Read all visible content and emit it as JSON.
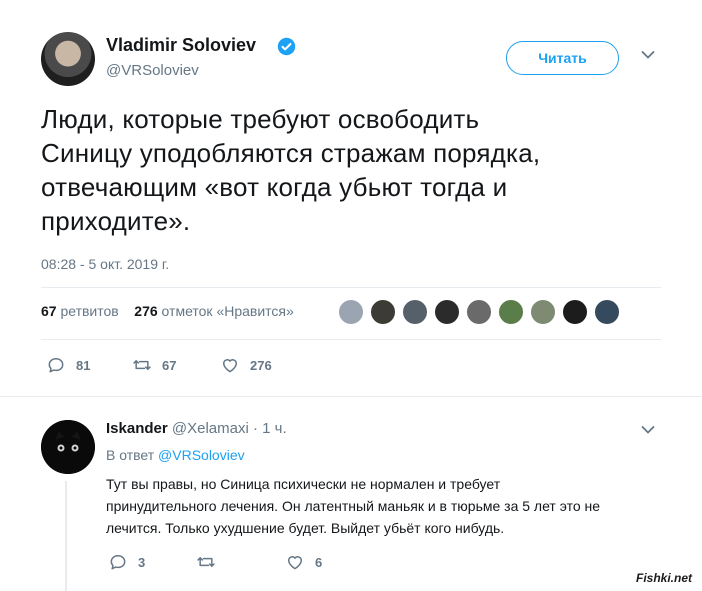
{
  "author": {
    "name": "Vladimir Soloviev",
    "handle": "@VRSoloviev",
    "verified": true
  },
  "follow_button": {
    "label": "Читать"
  },
  "tweet": {
    "text_lines": [
      "Люди, которые требуют освободить",
      "Синицу уподобляются стражам порядка,",
      "отвечающим «вот когда убьют тогда и",
      "приходите»."
    ],
    "timestamp": "08:28 - 5 окт. 2019 г."
  },
  "stats": {
    "retweets_count": "67",
    "retweets_label": "ретвитов",
    "likes_count": "276",
    "likes_label": "отметок «Нравится»"
  },
  "actions": {
    "reply_count": "81",
    "retweet_count": "67",
    "like_count": "276"
  },
  "reply": {
    "name": "Iskander",
    "handle": "@Xelamaxi",
    "time": "· 1 ч.",
    "reply_to_prefix": "В ответ",
    "reply_to_handle": "@VRSoloviev",
    "text_lines": [
      "Тут вы правы, но Синица психически не нормален и требует",
      "принудительного лечения. Он латентный маньяк и в тюрьме за 5 лет это не",
      "лечится. Только ухудшение будет. Выйдет убьёт кого нибудь."
    ],
    "actions": {
      "reply_count": "3",
      "retweet_count": "",
      "like_count": "6"
    }
  },
  "watermark": "Fishki.net",
  "colors": {
    "accent": "#1da1f2",
    "secondary_text": "#657786",
    "primary_text": "#14171a",
    "divider": "#e6ecf0"
  },
  "icons": [
    "verified-icon",
    "chevron-down-icon",
    "reply-icon",
    "retweet-icon",
    "like-icon"
  ]
}
